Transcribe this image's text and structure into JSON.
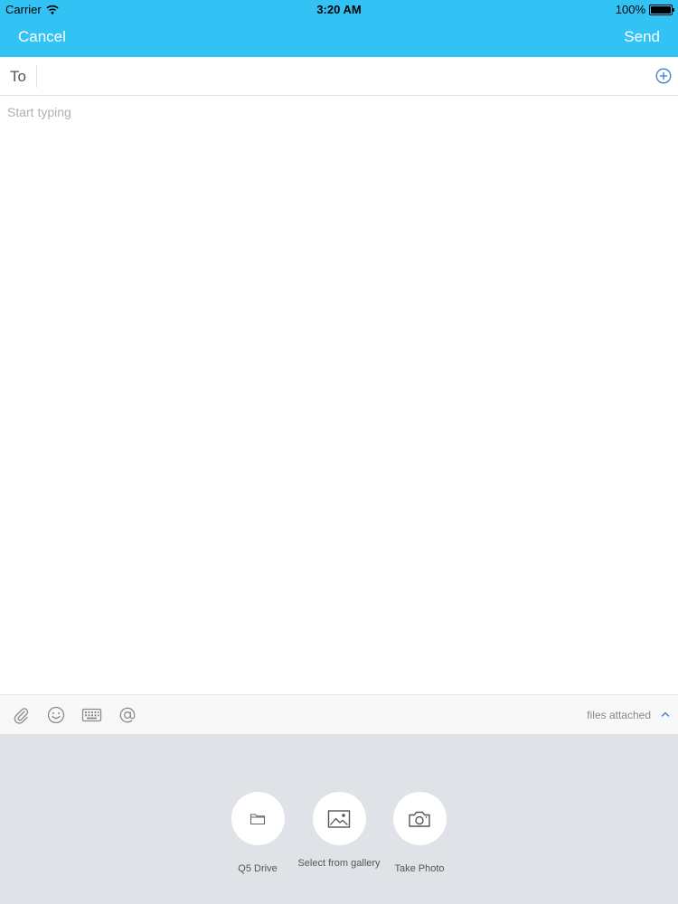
{
  "status_bar": {
    "carrier": "Carrier",
    "time": "3:20 AM",
    "battery": "100%",
    "wifi_icon": "wifi-icon",
    "battery_icon": "battery-icon"
  },
  "nav": {
    "cancel_label": "Cancel",
    "send_label": "Send",
    "background_color": "#33c2f4"
  },
  "recipient": {
    "label": "To",
    "value": "",
    "add_icon": "plus-circle-icon",
    "accent_color": "#3a7fd0"
  },
  "composer": {
    "placeholder": "Start typing",
    "value": ""
  },
  "toolbar": {
    "icons": [
      "paperclip-icon",
      "smiley-icon",
      "keyboard-icon",
      "at-sign-icon"
    ],
    "files_attached_label": "files attached",
    "expand_icon": "chevron-up-icon"
  },
  "attachments": {
    "options": [
      {
        "label": "Q5 Drive",
        "icon": "folder-icon"
      },
      {
        "label": "Select from gallery",
        "icon": "image-icon"
      },
      {
        "label": "Take Photo",
        "icon": "camera-icon"
      }
    ]
  }
}
